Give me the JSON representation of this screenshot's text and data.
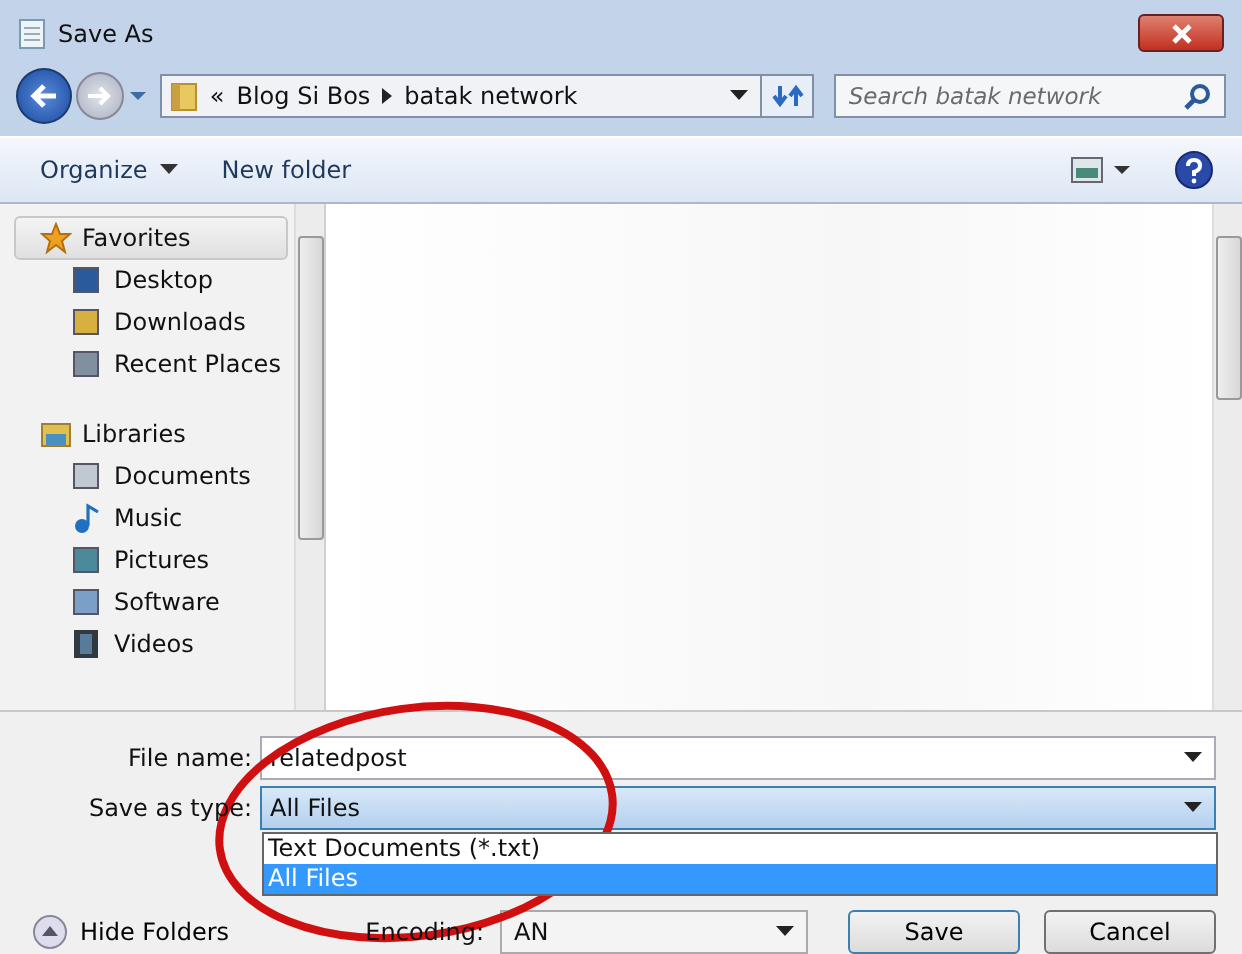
{
  "window": {
    "title": "Save As"
  },
  "address": {
    "crumbs": [
      "«",
      "Blog Si Bos",
      "batak network"
    ]
  },
  "search": {
    "placeholder": "Search batak network"
  },
  "toolbar": {
    "organize": "Organize",
    "new_folder": "New folder"
  },
  "sidebar": {
    "groups": [
      {
        "label": "Favorites",
        "selected": true,
        "children": [
          {
            "label": "Desktop"
          },
          {
            "label": "Downloads"
          },
          {
            "label": "Recent Places"
          }
        ]
      },
      {
        "label": "Libraries",
        "selected": false,
        "children": [
          {
            "label": "Documents"
          },
          {
            "label": "Music"
          },
          {
            "label": "Pictures"
          },
          {
            "label": "Software"
          },
          {
            "label": "Videos"
          }
        ]
      }
    ]
  },
  "form": {
    "file_name_label": "File name:",
    "file_name": "relatedpost",
    "type_label": "Save as type:",
    "type_value": "All Files",
    "type_options": [
      {
        "label": "Text Documents (*.txt)",
        "selected": false
      },
      {
        "label": "All Files",
        "selected": true
      }
    ],
    "encoding_label": "Encoding:",
    "encoding_value": "AN"
  },
  "hide_folders": "Hide Folders",
  "buttons": [
    "Save",
    "Cancel"
  ]
}
